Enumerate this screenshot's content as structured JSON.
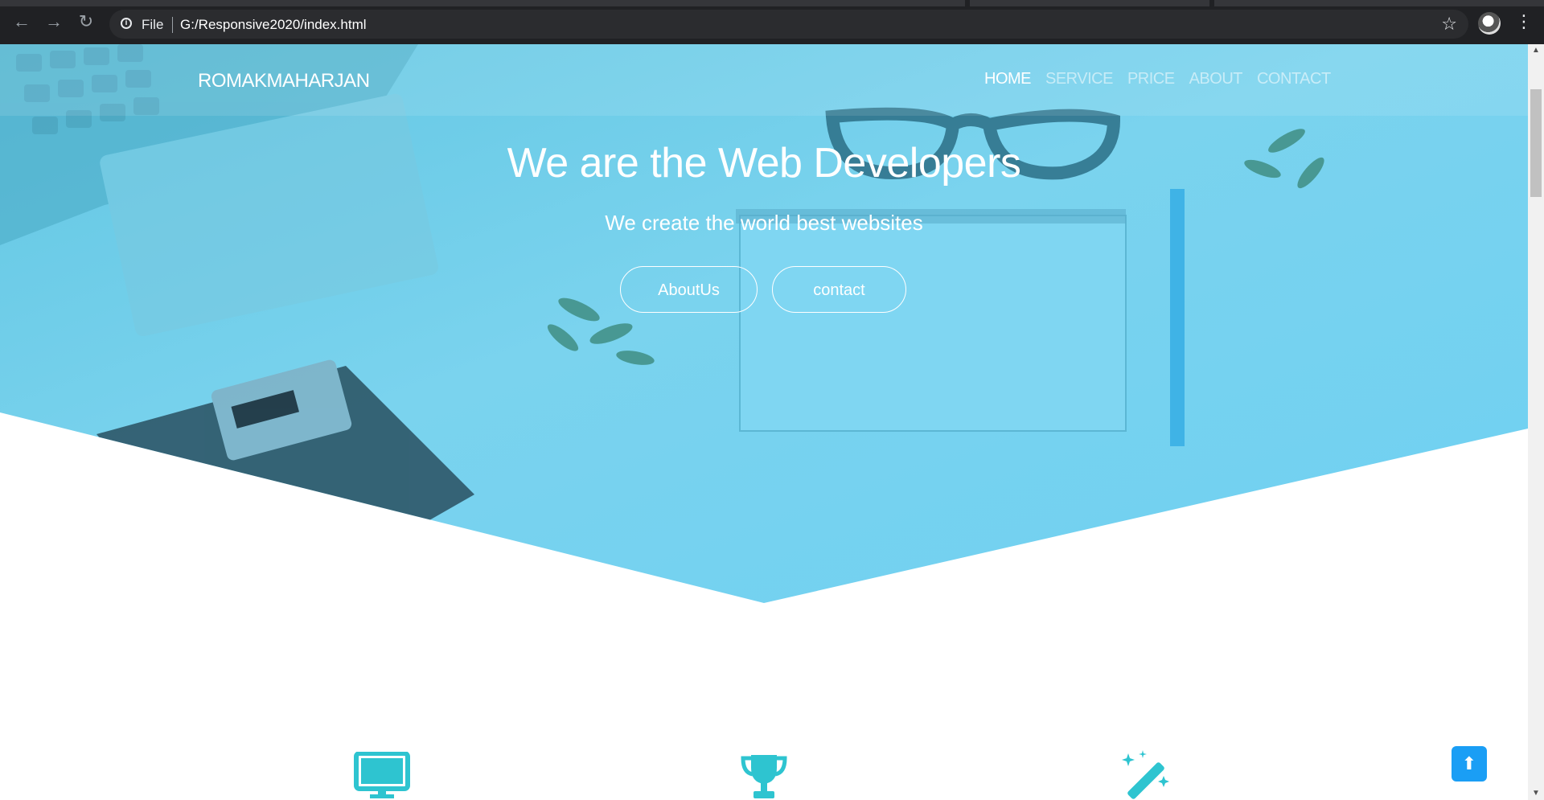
{
  "browser": {
    "back_icon": "arrow-left-icon",
    "forward_icon": "arrow-right-icon",
    "reload_icon": "reload-icon",
    "info_icon": "info-icon",
    "scheme_label": "File",
    "url": "G:/Responsive2020/index.html",
    "bookmark_icon": "star-icon",
    "menu_icon": "vertical-dots-icon"
  },
  "site": {
    "brand": "ROMAKMAHARJAN",
    "nav": [
      "HOME",
      "SERVICE",
      "PRICE",
      "ABOUT",
      "CONTACT"
    ],
    "active_nav": "HOME",
    "hero": {
      "title": "We are the Web Developers",
      "subtitle": "We create the world best websites",
      "buttons": [
        "AboutUs",
        "contact"
      ]
    },
    "features": {
      "icons": [
        "monitor-icon",
        "trophy-icon",
        "magic-wand-icon"
      ],
      "accent": "#2ec4d0"
    },
    "scroll_top_icon": "arrow-circle-up-icon"
  },
  "colors": {
    "hero_overlay": "#6fd0f0",
    "accent": "#2ec4d0",
    "scroll_top_button": "#1a9ef5"
  }
}
